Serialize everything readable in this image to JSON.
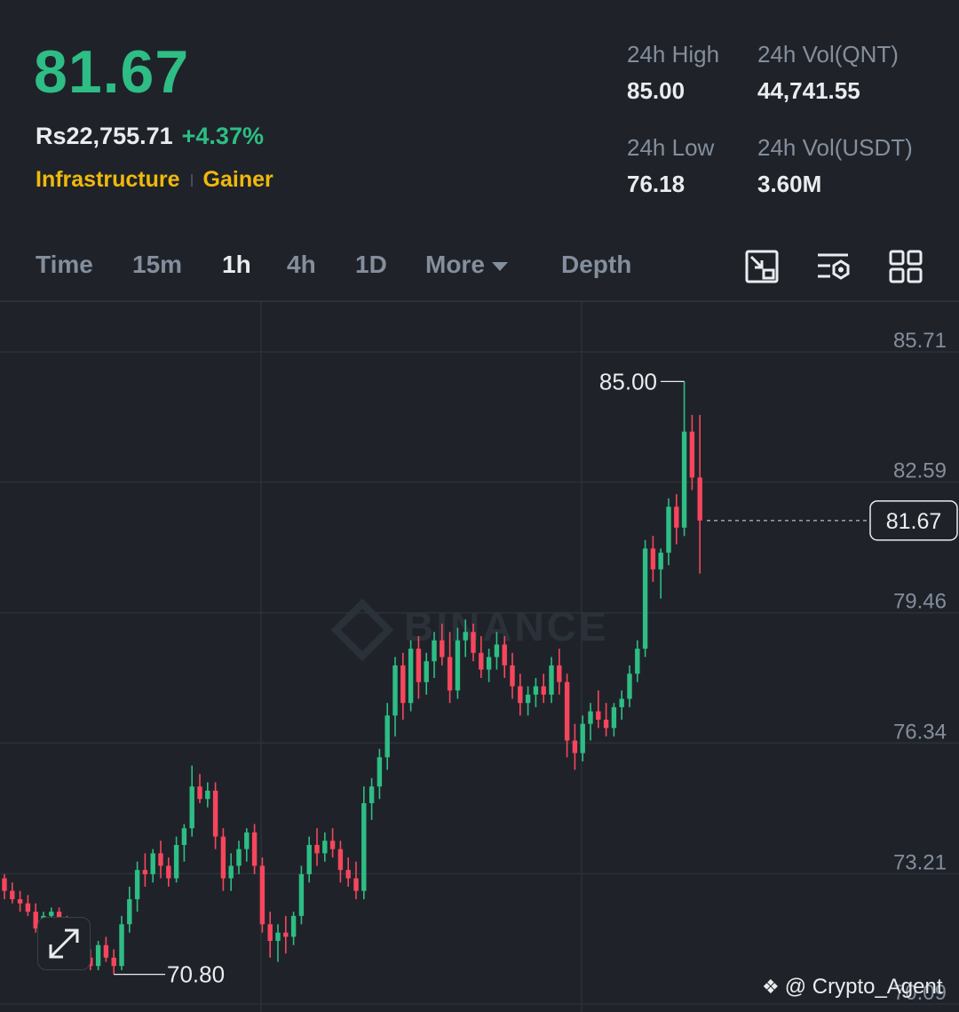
{
  "header": {
    "price": "81.67",
    "fiat_price": "Rs22,755.71",
    "change": "+4.37%",
    "tags": [
      "Infrastructure",
      "Gainer"
    ],
    "stats": {
      "high_label": "24h High",
      "high_value": "85.00",
      "vol_qnt_label": "24h Vol(QNT)",
      "vol_qnt_value": "44,741.55",
      "low_label": "24h Low",
      "low_value": "76.18",
      "vol_usdt_label": "24h Vol(USDT)",
      "vol_usdt_value": "3.60M"
    }
  },
  "tabs": {
    "time": "Time",
    "m15": "15m",
    "h1": "1h",
    "h4": "4h",
    "d1": "1D",
    "more": "More",
    "depth": "Depth",
    "active": "1h"
  },
  "toolbar_icons": [
    "chart-settings-icon",
    "indicator-settings-icon",
    "grid-layout-icon"
  ],
  "colors": {
    "up": "#2ebd85",
    "down": "#f6465d",
    "accent": "#f0b90b",
    "bg": "#1f2329",
    "grid": "#2b3139",
    "muted": "#848e9c"
  },
  "watermark": "BINANCE",
  "credit": "@ Crypto_Agent",
  "chart_data": {
    "type": "candlestick",
    "y_ticks": [
      "85.71",
      "82.59",
      "79.46",
      "76.34",
      "73.21",
      "70.09"
    ],
    "ylim": [
      70.09,
      85.71
    ],
    "current_price": "81.67",
    "current_value": 81.67,
    "high_label": "85.00",
    "high_value": 85.0,
    "low_label": "70.80",
    "low_value": 70.8,
    "candles": [
      [
        73.1,
        73.2,
        72.6,
        72.8
      ],
      [
        72.8,
        73.0,
        72.5,
        72.6
      ],
      [
        72.6,
        72.8,
        72.3,
        72.5
      ],
      [
        72.5,
        72.7,
        72.2,
        72.3
      ],
      [
        72.3,
        72.5,
        71.8,
        71.9
      ],
      [
        71.9,
        72.3,
        71.8,
        72.2
      ],
      [
        72.2,
        72.4,
        72.0,
        72.3
      ],
      [
        72.3,
        72.4,
        71.8,
        71.9
      ],
      [
        71.9,
        72.2,
        71.5,
        71.6
      ],
      [
        71.6,
        71.8,
        71.2,
        71.4
      ],
      [
        71.4,
        71.6,
        71.0,
        71.2
      ],
      [
        71.2,
        71.4,
        70.9,
        71.0
      ],
      [
        71.0,
        71.6,
        70.9,
        71.5
      ],
      [
        71.5,
        71.7,
        71.1,
        71.2
      ],
      [
        71.2,
        71.4,
        70.8,
        71.0
      ],
      [
        71.0,
        72.2,
        70.9,
        72.0
      ],
      [
        72.0,
        72.9,
        71.8,
        72.6
      ],
      [
        72.6,
        73.5,
        72.3,
        73.3
      ],
      [
        73.3,
        73.7,
        72.9,
        73.2
      ],
      [
        73.2,
        73.8,
        73.0,
        73.7
      ],
      [
        73.7,
        74.0,
        73.1,
        73.4
      ],
      [
        73.4,
        73.6,
        72.9,
        73.1
      ],
      [
        73.1,
        74.1,
        73.0,
        73.9
      ],
      [
        73.9,
        74.4,
        73.5,
        74.3
      ],
      [
        74.3,
        75.8,
        74.1,
        75.3
      ],
      [
        75.3,
        75.6,
        74.9,
        75.0
      ],
      [
        75.0,
        75.4,
        74.8,
        75.2
      ],
      [
        75.2,
        75.4,
        73.8,
        74.1
      ],
      [
        74.1,
        74.3,
        72.8,
        73.1
      ],
      [
        73.1,
        73.7,
        72.8,
        73.4
      ],
      [
        73.4,
        74.0,
        73.2,
        73.8
      ],
      [
        73.8,
        74.3,
        73.5,
        74.2
      ],
      [
        74.2,
        74.4,
        73.2,
        73.4
      ],
      [
        73.4,
        73.6,
        71.8,
        72.0
      ],
      [
        72.0,
        72.3,
        71.2,
        71.6
      ],
      [
        71.6,
        72.0,
        71.1,
        71.8
      ],
      [
        71.8,
        72.2,
        71.3,
        71.7
      ],
      [
        71.7,
        72.3,
        71.5,
        72.2
      ],
      [
        72.2,
        73.4,
        72.0,
        73.2
      ],
      [
        73.2,
        74.1,
        73.0,
        73.9
      ],
      [
        73.9,
        74.3,
        73.4,
        73.7
      ],
      [
        73.7,
        74.2,
        73.5,
        74.0
      ],
      [
        74.0,
        74.3,
        73.6,
        73.8
      ],
      [
        73.8,
        74.0,
        73.0,
        73.3
      ],
      [
        73.3,
        73.6,
        72.9,
        73.1
      ],
      [
        73.1,
        73.5,
        72.6,
        72.8
      ],
      [
        72.8,
        75.3,
        72.6,
        74.9
      ],
      [
        74.9,
        75.5,
        74.5,
        75.3
      ],
      [
        75.3,
        76.2,
        75.0,
        76.0
      ],
      [
        76.0,
        77.3,
        75.7,
        77.0
      ],
      [
        77.0,
        78.4,
        76.5,
        78.2
      ],
      [
        78.2,
        78.5,
        76.9,
        77.3
      ],
      [
        77.3,
        78.8,
        77.1,
        78.6
      ],
      [
        78.6,
        78.9,
        77.4,
        77.8
      ],
      [
        77.8,
        78.5,
        77.5,
        78.3
      ],
      [
        78.3,
        79.0,
        77.9,
        78.8
      ],
      [
        78.8,
        79.2,
        78.2,
        78.4
      ],
      [
        78.4,
        79.0,
        77.3,
        77.6
      ],
      [
        77.6,
        79.1,
        77.4,
        78.8
      ],
      [
        78.8,
        79.3,
        78.4,
        79.0
      ],
      [
        79.0,
        79.2,
        78.3,
        78.5
      ],
      [
        78.5,
        78.9,
        77.9,
        78.1
      ],
      [
        78.1,
        78.6,
        77.8,
        78.4
      ],
      [
        78.4,
        79.0,
        78.1,
        78.7
      ],
      [
        78.7,
        78.9,
        77.9,
        78.2
      ],
      [
        78.2,
        78.5,
        77.4,
        77.7
      ],
      [
        77.7,
        78.0,
        77.0,
        77.3
      ],
      [
        77.3,
        77.7,
        77.0,
        77.5
      ],
      [
        77.5,
        77.9,
        77.2,
        77.7
      ],
      [
        77.7,
        78.0,
        77.3,
        77.5
      ],
      [
        77.5,
        78.4,
        77.3,
        78.2
      ],
      [
        78.2,
        78.6,
        77.5,
        77.8
      ],
      [
        77.8,
        78.0,
        76.0,
        76.4
      ],
      [
        76.4,
        76.8,
        75.7,
        76.1
      ],
      [
        76.1,
        77.0,
        75.9,
        76.8
      ],
      [
        76.8,
        77.3,
        76.4,
        77.1
      ],
      [
        77.1,
        77.6,
        76.7,
        76.9
      ],
      [
        76.9,
        77.3,
        76.5,
        76.7
      ],
      [
        76.7,
        77.3,
        76.5,
        77.2
      ],
      [
        77.2,
        77.6,
        76.9,
        77.4
      ],
      [
        77.4,
        78.2,
        77.2,
        78.0
      ],
      [
        78.0,
        78.8,
        77.8,
        78.6
      ],
      [
        78.6,
        81.2,
        78.4,
        81.0
      ],
      [
        81.0,
        81.3,
        80.2,
        80.5
      ],
      [
        80.5,
        81.0,
        79.8,
        80.9
      ],
      [
        80.9,
        82.2,
        80.6,
        82.0
      ],
      [
        82.0,
        82.3,
        81.1,
        81.5
      ],
      [
        81.5,
        85.0,
        81.3,
        83.8
      ],
      [
        83.8,
        84.2,
        82.4,
        82.7
      ],
      [
        82.7,
        84.2,
        80.4,
        81.67
      ]
    ]
  }
}
